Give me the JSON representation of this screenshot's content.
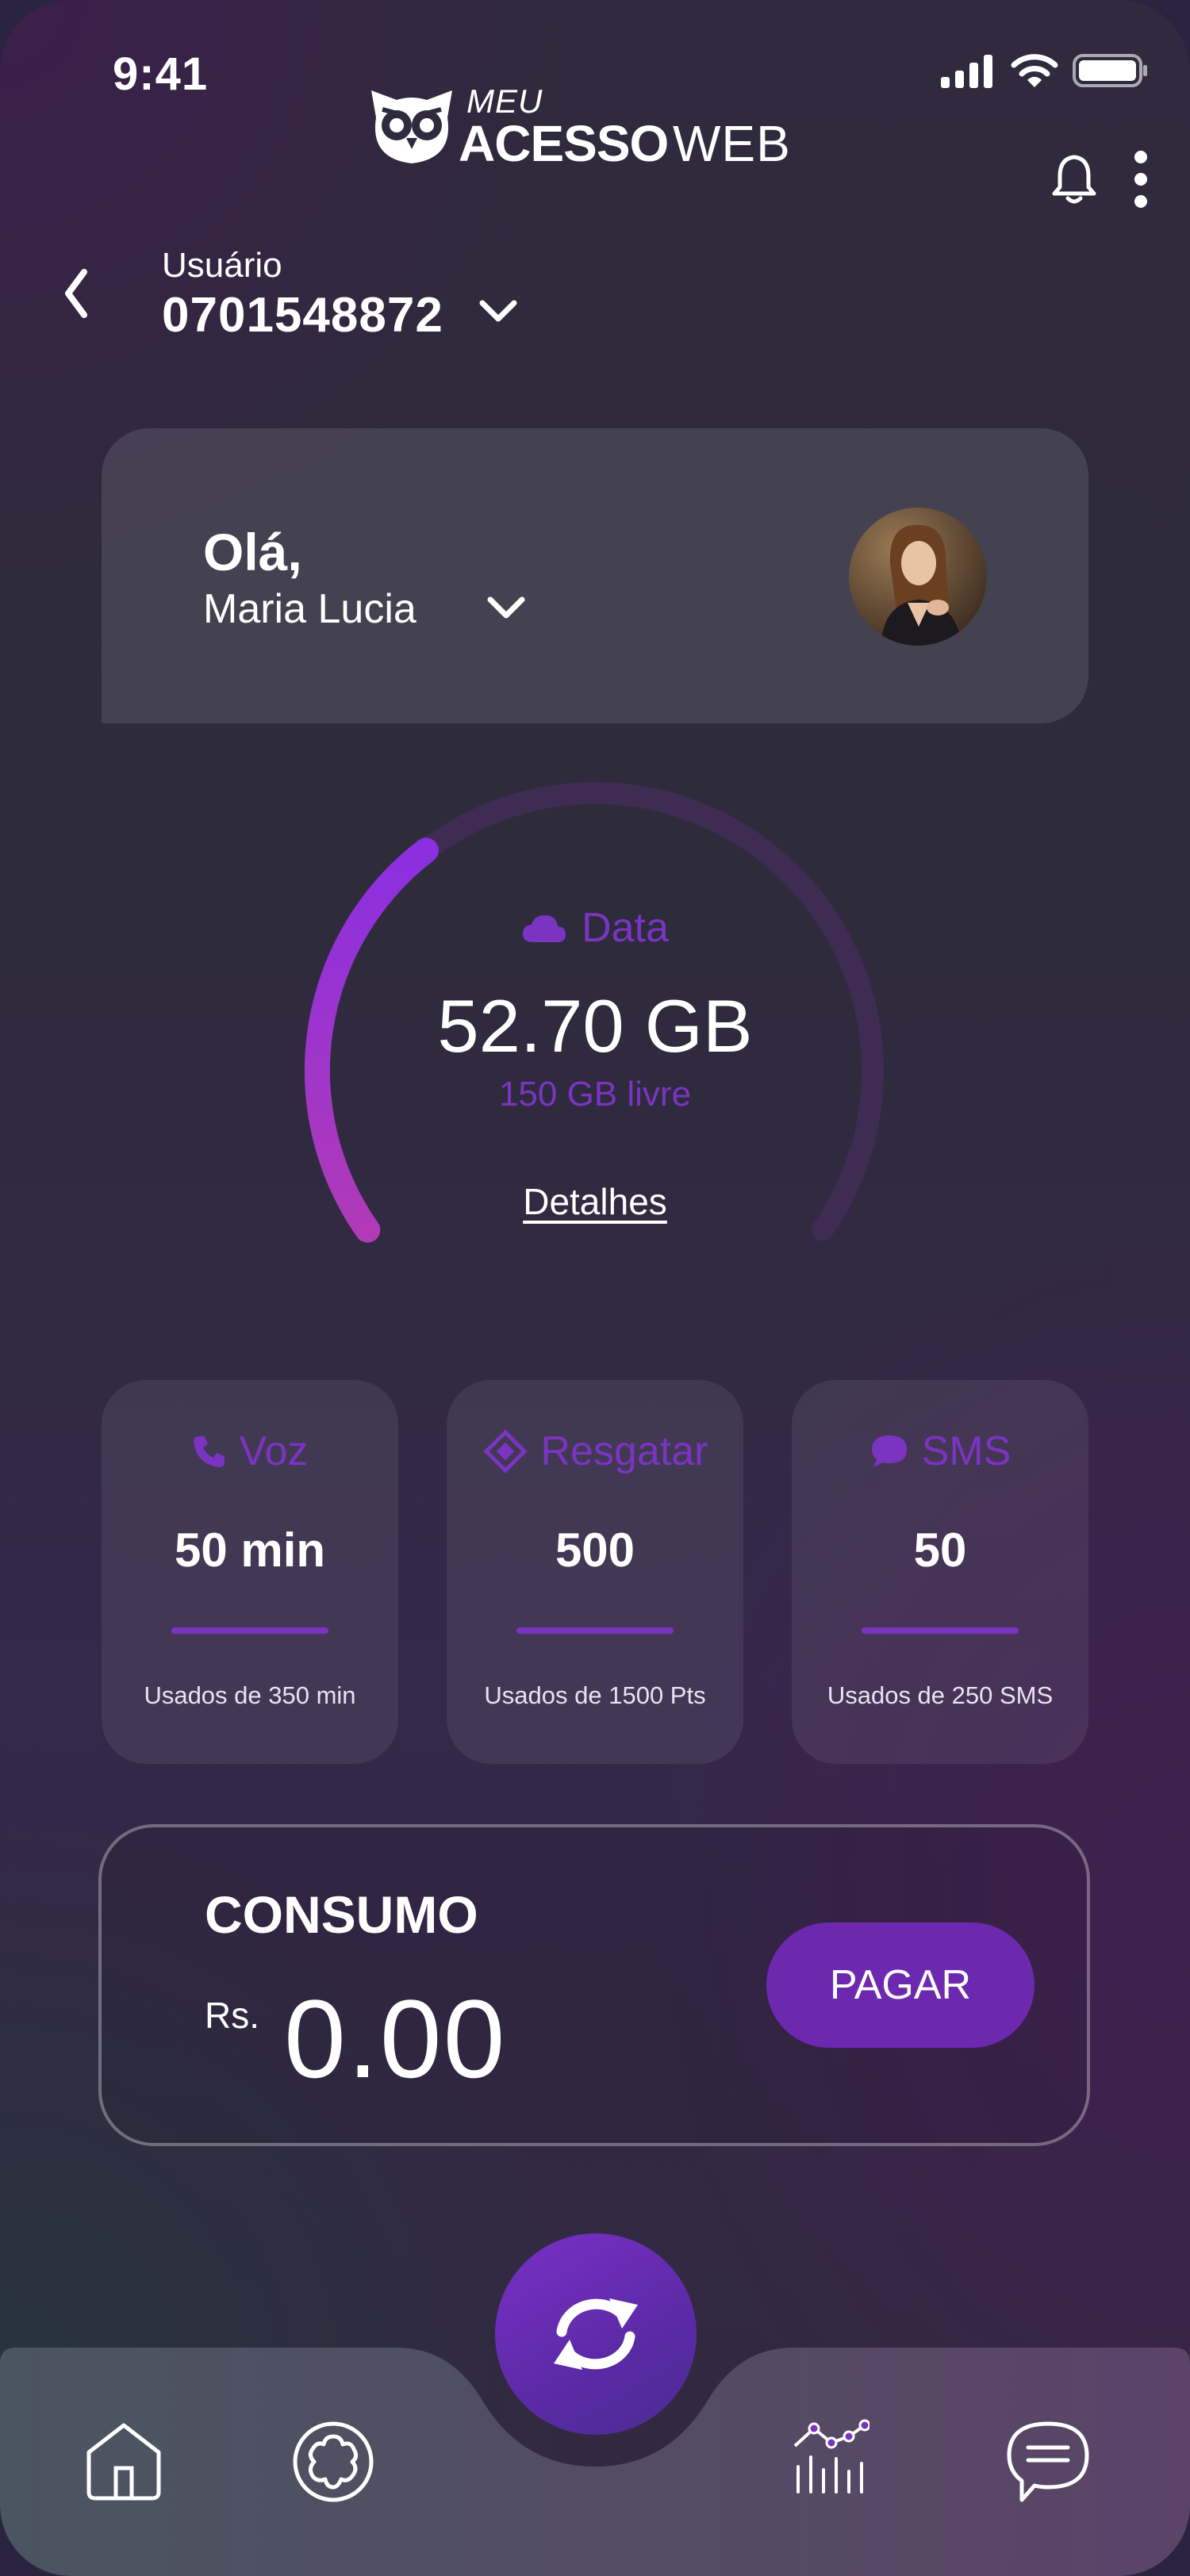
{
  "status": {
    "time": "9:41"
  },
  "logo": {
    "top": "MEU",
    "bold": "ACESSO",
    "light": "WEB"
  },
  "user": {
    "label": "Usuário",
    "number": "0701548872"
  },
  "greeting": {
    "hello": "Olá,",
    "name": "Maria Lucia"
  },
  "data": {
    "label": "Data",
    "used": "52.70 GB",
    "free": "150 GB livre",
    "link": "Detalhes",
    "fraction": 0.35
  },
  "stats": [
    {
      "title": "Voz",
      "icon": "phone-icon",
      "value": "50 min",
      "sub": "Usados de 350 min"
    },
    {
      "title": "Resgatar",
      "icon": "diamond-icon",
      "value": "500",
      "sub": "Usados de 1500 Pts"
    },
    {
      "title": "SMS",
      "icon": "chat-bubble-icon",
      "value": "50",
      "sub": "Usados de 250 SMS"
    }
  ],
  "consumo": {
    "title": "CONSUMO",
    "currency": "Rs.",
    "amount": "0.00",
    "button": "PAGAR"
  },
  "colors": {
    "accent": "#7b34c2",
    "button": "#6d28b0",
    "gauge_track": "#3e2c52"
  }
}
